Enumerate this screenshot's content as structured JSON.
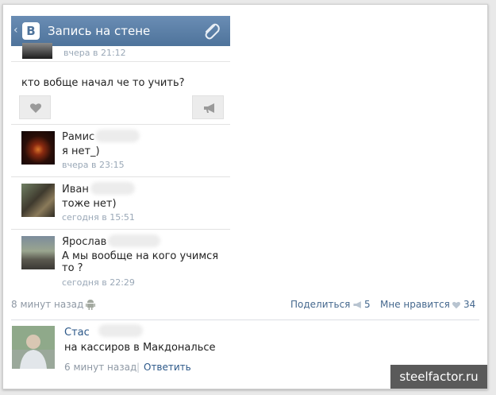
{
  "header": {
    "title": "Запись на стене",
    "logo_letter": "B",
    "back_glyph": "‹"
  },
  "previous": {
    "time": "вчера в 21:12"
  },
  "post": {
    "text": "кто вобще начал че то учить?"
  },
  "comments": [
    {
      "author": "Рамис",
      "text": "я нет_)",
      "time": "вчера в 23:15"
    },
    {
      "author": "Иван",
      "text": "тоже нет)",
      "time": "сегодня в 15:51"
    },
    {
      "author": "Ярослав",
      "text": "А мы вообще на кого учимся то ?",
      "time": "сегодня в 22:29"
    }
  ],
  "footer": {
    "posted_ago": "8 минут назад",
    "share_label": "Поделиться",
    "share_count": "5",
    "like_label": "Мне нравится",
    "like_count": "34"
  },
  "reply": {
    "author": "Стас",
    "text": "на кассиров в Макдональсе",
    "time": "6 минут назад",
    "separator": "|",
    "reply_link": "Ответить"
  },
  "watermark": "steelfactor.ru",
  "colors": {
    "header_blue": "#5b7fa6",
    "link_blue": "#45688e",
    "meta_gray": "#9aa8b7"
  },
  "icons": [
    "back-chevron-icon",
    "vk-logo-icon",
    "paperclip-icon",
    "heart-icon",
    "megaphone-icon",
    "android-icon"
  ]
}
